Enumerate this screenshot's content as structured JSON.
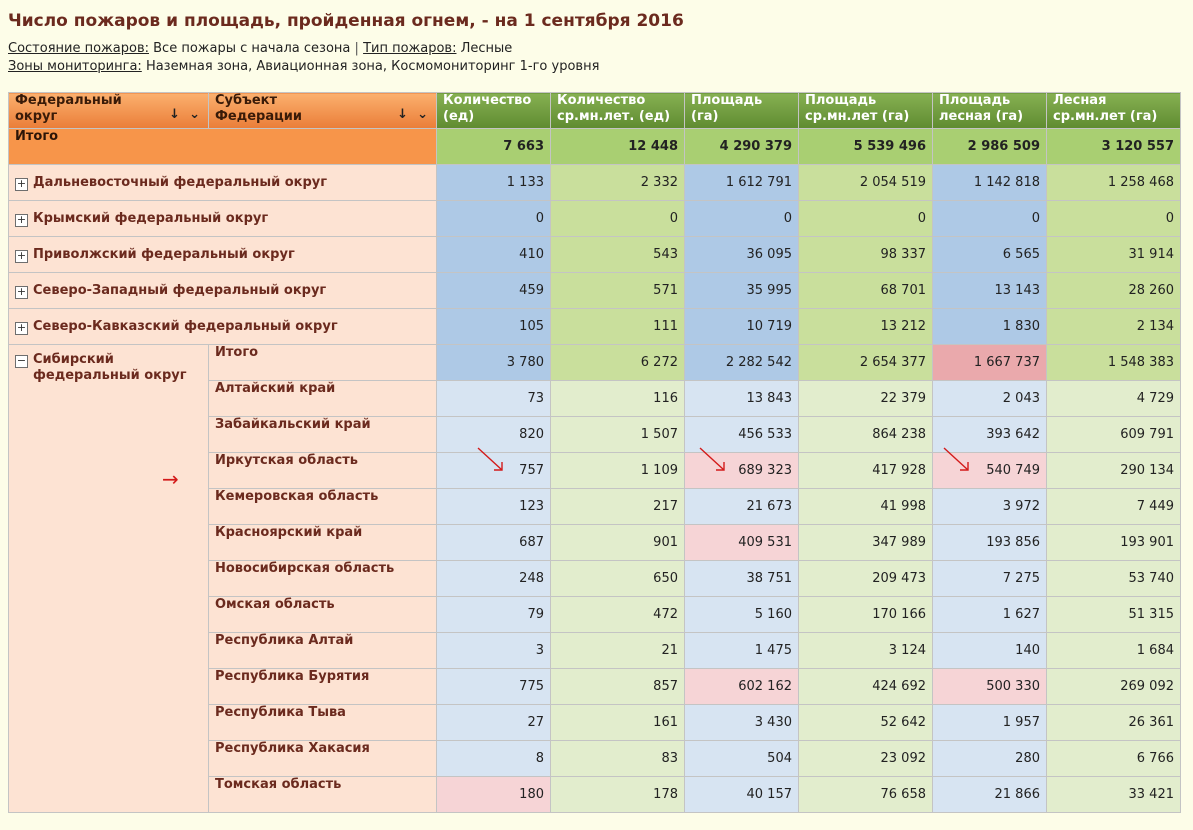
{
  "title": "Число пожаров и площадь, пройденная огнем, - на 1 сентября 2016",
  "filters": {
    "state_label": "Состояние пожаров:",
    "state_value": "Все пожары с начала сезона",
    "separator": "|",
    "type_label": "Тип пожаров:",
    "type_value": "Лесные",
    "zones_label": "Зоны мониторинга:",
    "zones_value": "Наземная зона, Авиационная зона, Космомониторинг 1-го уровня"
  },
  "headers": {
    "dim1": [
      "Федеральный",
      "округ"
    ],
    "dim2": [
      "Субъект",
      "Федерации"
    ],
    "sort_icon": "↓",
    "dropdown_icon": "⌄",
    "measures": [
      [
        "Количество",
        "(ед)"
      ],
      [
        "Количество",
        "ср.мн.лет. (ед)"
      ],
      [
        "Площадь",
        "(га)"
      ],
      [
        "Площадь",
        "ср.мн.лет (га)"
      ],
      [
        "Площадь",
        "лесная (га)"
      ],
      [
        "Лесная",
        "ср.мн.лет (га)"
      ]
    ]
  },
  "total": {
    "label": "Итого",
    "values": [
      "7 663",
      "12 448",
      "4 290 379",
      "5 539 496",
      "2 986 509",
      "3 120 557"
    ]
  },
  "expand_icon": "+",
  "collapse_icon": "−",
  "districts": [
    {
      "name": "Дальневосточный федеральный округ",
      "values": [
        "1 133",
        "2 332",
        "1 612 791",
        "2 054 519",
        "1 142 818",
        "1 258 468"
      ]
    },
    {
      "name": "Крымский федеральный округ",
      "values": [
        "0",
        "0",
        "0",
        "0",
        "0",
        "0"
      ]
    },
    {
      "name": "Приволжский федеральный округ",
      "values": [
        "410",
        "543",
        "36 095",
        "98 337",
        "6 565",
        "31 914"
      ]
    },
    {
      "name": "Северо-Западный федеральный округ",
      "values": [
        "459",
        "571",
        "35 995",
        "68 701",
        "13 143",
        "28 260"
      ]
    },
    {
      "name": "Северо-Кавказский федеральный округ",
      "values": [
        "105",
        "111",
        "10 719",
        "13 212",
        "1 830",
        "2 134"
      ]
    }
  ],
  "siberia": {
    "name": [
      "Сибирский",
      "федеральный округ"
    ],
    "total_label": "Итого",
    "total_values": [
      "3 780",
      "6 272",
      "2 282 542",
      "2 654 377",
      "1 667 737",
      "1 548 383"
    ],
    "subjects": [
      {
        "name": "Алтайский край",
        "values": [
          "73",
          "116",
          "13 843",
          "22 379",
          "2 043",
          "4 729"
        ]
      },
      {
        "name": "Забайкальский край",
        "values": [
          "820",
          "1 507",
          "456 533",
          "864 238",
          "393 642",
          "609 791"
        ]
      },
      {
        "name": "Иркутская область",
        "values": [
          "757",
          "1 109",
          "689 323",
          "417 928",
          "540 749",
          "290 134"
        ]
      },
      {
        "name": "Кемеровская область",
        "values": [
          "123",
          "217",
          "21 673",
          "41 998",
          "3 972",
          "7 449"
        ]
      },
      {
        "name": "Красноярский край",
        "values": [
          "687",
          "901",
          "409 531",
          "347 989",
          "193 856",
          "193 901"
        ]
      },
      {
        "name": "Новосибирская область",
        "values": [
          "248",
          "650",
          "38 751",
          "209 473",
          "7 275",
          "53 740"
        ]
      },
      {
        "name": "Омская область",
        "values": [
          "79",
          "472",
          "5 160",
          "170 166",
          "1 627",
          "51 315"
        ]
      },
      {
        "name": "Республика Алтай",
        "values": [
          "3",
          "21",
          "1 475",
          "3 124",
          "140",
          "1 684"
        ]
      },
      {
        "name": "Республика Бурятия",
        "values": [
          "775",
          "857",
          "602 162",
          "424 692",
          "500 330",
          "269 092"
        ]
      },
      {
        "name": "Республика Тыва",
        "values": [
          "27",
          "161",
          "3 430",
          "52 642",
          "1 957",
          "26 361"
        ]
      },
      {
        "name": "Республика Хакасия",
        "values": [
          "8",
          "83",
          "504",
          "23 092",
          "280",
          "6 766"
        ]
      },
      {
        "name": "Томская область",
        "values": [
          "180",
          "178",
          "40 157",
          "76 658",
          "21 866",
          "33 421"
        ]
      }
    ]
  },
  "annotation_arrow": "→",
  "colors": {
    "title": "#6b2a1e",
    "header_dim": "#ea7d38",
    "header_measure": "#5f8b30",
    "highlight_pink": "#f6d4d6",
    "highlight_deep_pink": "#eaa9ac",
    "annotation": "#d31a1a"
  }
}
